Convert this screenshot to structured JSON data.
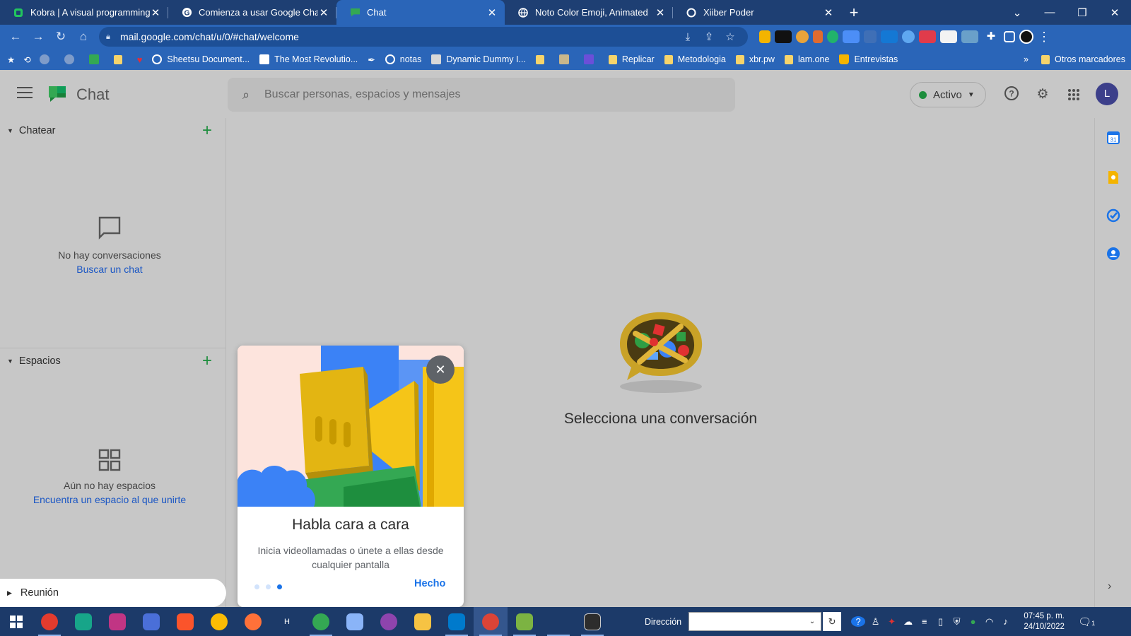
{
  "browser": {
    "tabs": [
      {
        "title": "Kobra | A visual programming lar",
        "icon": "kobra-icon",
        "color": "#22c55e"
      },
      {
        "title": "Comienza a usar Google Chat - C",
        "icon": "google-icon",
        "color": "#ffffff"
      },
      {
        "title": "Chat",
        "icon": "google-chat-icon",
        "color": "#34a853",
        "active": true
      },
      {
        "title": "Noto Color Emoji, Animated",
        "icon": "globe-icon",
        "color": "#ffffff"
      },
      {
        "title": "Xiiber Poder",
        "icon": "circle-icon",
        "color": "#ffffff"
      }
    ],
    "url": "mail.google.com/chat/u/0/#chat/welcome",
    "bookmarks": [
      {
        "label": "Sheetsu Document...",
        "icon": "globe-icon"
      },
      {
        "label": "The Most Revolutio...",
        "icon": "page-icon"
      },
      {
        "label": "notas",
        "icon": "globe-icon"
      },
      {
        "label": "Dynamic Dummy I...",
        "icon": "page-icon"
      },
      {
        "label": "Replicar",
        "icon": "folder-icon"
      },
      {
        "label": "Metodologia",
        "icon": "folder-icon"
      },
      {
        "label": "xbr.pw",
        "icon": "folder-icon"
      },
      {
        "label": "lam.one",
        "icon": "folder-icon"
      },
      {
        "label": "Entrevistas",
        "icon": "drive-icon"
      }
    ],
    "other_bookmarks": "Otros marcadores"
  },
  "app": {
    "title": "Chat",
    "search_placeholder": "Buscar personas, espacios y mensajes",
    "status": "Activo",
    "avatar_letter": "L"
  },
  "sidebar": {
    "chats": {
      "header": "Chatear",
      "empty_text": "No hay conversaciones",
      "empty_link": "Buscar un chat"
    },
    "spaces": {
      "header": "Espacios",
      "empty_text": "Aún no hay espacios",
      "empty_link": "Encuentra un espacio al que unirte"
    },
    "meeting": "Reunión"
  },
  "main": {
    "select_text": "Selecciona una conversación"
  },
  "popup": {
    "title": "Habla cara a cara",
    "body": "Inicia videollamadas o únete a ellas desde cualquier pantalla",
    "done": "Hecho",
    "pages_total": 3,
    "current_page": 3
  },
  "taskbar": {
    "address_label": "Dirección",
    "time": "07:45 p. m.",
    "date": "24/10/2022",
    "notification_count": "1"
  },
  "colors": {
    "chrome_dark": "#1e3f73",
    "chrome_blue": "#2a65b8",
    "accent_green": "#1e8e3e",
    "link_blue": "#1a56c4",
    "google_blue": "#1a73e8"
  }
}
